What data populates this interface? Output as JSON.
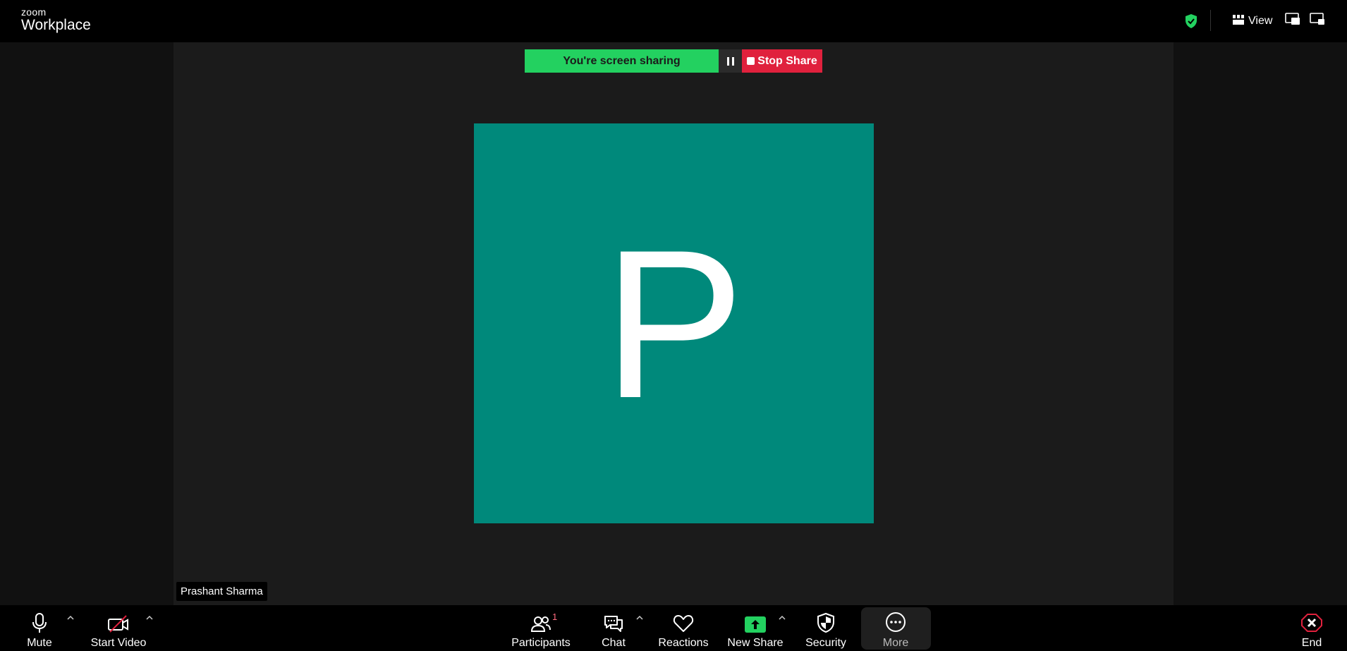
{
  "brand": {
    "small": "zoom",
    "big": "Workplace"
  },
  "top_bar": {
    "view_label": "View"
  },
  "share_bar": {
    "status": "You're screen sharing",
    "stop_label": "Stop Share"
  },
  "video": {
    "avatar_letter": "P",
    "participant_name": "Prashant Sharma",
    "avatar_color": "#00897b"
  },
  "toolbar": {
    "mute": "Mute",
    "start_video": "Start Video",
    "participants": "Participants",
    "participants_count": "1",
    "chat": "Chat",
    "reactions": "Reactions",
    "new_share": "New Share",
    "security": "Security",
    "more": "More",
    "end": "End"
  },
  "colors": {
    "sharing_green": "#23d160",
    "stop_red": "#e0213d",
    "encryption_green": "#23d160"
  }
}
